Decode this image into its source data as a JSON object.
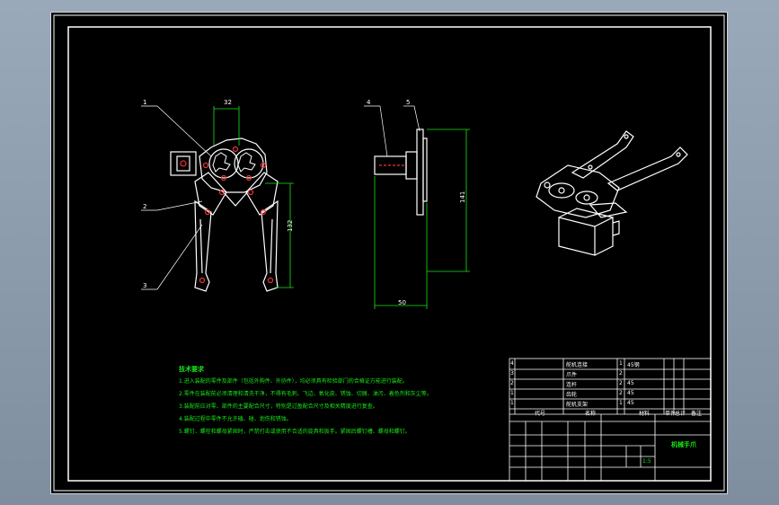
{
  "drawing": {
    "part_labels": [
      "1",
      "2",
      "3",
      "4",
      "5"
    ],
    "dimensions": {
      "front_width": "32",
      "front_height": "132",
      "side_width": "50",
      "side_height": "141"
    }
  },
  "tech_requirements": {
    "title": "技术要求",
    "items": [
      "1.进入装配的零件及部件（包括外购件、外协件），均必须具有检验部门的合格证方能进行装配。",
      "2.零件在装配前必须清理和清洗干净，不得有毛刺、飞边、氧化皮、锈蚀、切屑、油污、着色剂和灰尘等。",
      "3.装配前应对零、部件的主要配合尺寸，特别是过盈配合尺寸及相关精度进行复查。",
      "4.装配过程中零件不允许磕、碰、划伤和锈蚀。",
      "5.螺钉、螺栓和螺母紧固时，严禁打击或使用不合适的旋具和扳手。紧固后螺钉槽、螺母和螺钉。"
    ]
  },
  "title_block": {
    "bom_rows": [
      {
        "no": "4",
        "name": "舵机连接",
        "qty": "1",
        "material": "45钢"
      },
      {
        "no": "3",
        "name": "爪件",
        "qty": "2",
        "material": ""
      },
      {
        "no": "2",
        "name": "连杆",
        "qty": "2",
        "material": "45"
      },
      {
        "no": "1",
        "name": "齿轮",
        "qty": "2",
        "material": "45"
      },
      {
        "no": "1",
        "name": "舵机支架",
        "qty": "1",
        "material": "45"
      }
    ],
    "header": {
      "code": "代号",
      "name": "名称",
      "material": "材料",
      "unit": "单件",
      "total": "总计",
      "note": "备注"
    },
    "drawing_title": "机械手爪",
    "scale": "1:5"
  }
}
